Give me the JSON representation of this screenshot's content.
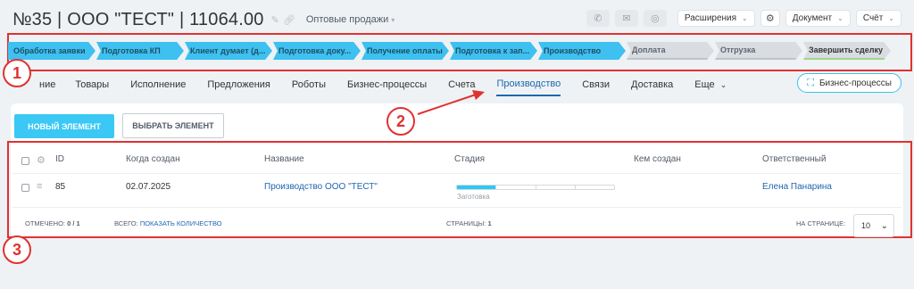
{
  "header": {
    "title": "№35 | ООО \"ТЕСТ\" | 11064.00",
    "category": "Оптовые продажи",
    "extensions_label": "Расширения",
    "document_label": "Документ",
    "invoice_label": "Счёт"
  },
  "stages": [
    {
      "label": "Обработка заявки",
      "state": "done"
    },
    {
      "label": "Подготовка КП",
      "state": "done"
    },
    {
      "label": "Клиент думает (д...",
      "state": "done"
    },
    {
      "label": "Подготовка доку...",
      "state": "done"
    },
    {
      "label": "Получение оплаты",
      "state": "done"
    },
    {
      "label": "Подготовка к зап...",
      "state": "done"
    },
    {
      "label": "Производство",
      "state": "done"
    },
    {
      "label": "Доплата",
      "state": "todo"
    },
    {
      "label": "Отгрузка",
      "state": "todo"
    },
    {
      "label": "Завершить сделку",
      "state": "final"
    }
  ],
  "annotations": [
    "1",
    "2",
    "3"
  ],
  "tabs": [
    {
      "label": "ние",
      "active": false
    },
    {
      "label": "Товары",
      "active": false
    },
    {
      "label": "Исполнение",
      "active": false
    },
    {
      "label": "Предложения",
      "active": false
    },
    {
      "label": "Роботы",
      "active": false
    },
    {
      "label": "Бизнес-процессы",
      "active": false
    },
    {
      "label": "Счета",
      "active": false
    },
    {
      "label": "Производство",
      "active": true
    },
    {
      "label": "Связи",
      "active": false
    },
    {
      "label": "Доставка",
      "active": false
    },
    {
      "label": "Еще",
      "active": false
    }
  ],
  "bp_button_label": "Бизнес-процессы",
  "toolbar": {
    "new_element": "НОВЫЙ ЭЛЕМЕНТ",
    "select_element": "ВЫБРАТЬ ЭЛЕМЕНТ"
  },
  "grid": {
    "columns": [
      "ID",
      "Когда создан",
      "Название",
      "Стадия",
      "Кем создан",
      "Ответственный"
    ],
    "rows": [
      {
        "id": "85",
        "created": "02.07.2025",
        "name": "Производство ООО \"ТЕСТ\"",
        "stage": "Заготовка",
        "stage_progress": "1 of 4",
        "created_by": "",
        "responsible": "Елена Панарина"
      }
    ]
  },
  "footer": {
    "checked_label": "ОТМЕЧЕНО:",
    "checked_value": "0 / 1",
    "total_label": "ВСЕГО:",
    "total_link": "ПОКАЗАТЬ КОЛИЧЕСТВО",
    "pages_label": "СТРАНИЦЫ:",
    "pages_value": "1",
    "per_page_label": "НА СТРАНИЦЕ:",
    "per_page_value": "10"
  },
  "colors": {
    "accent": "#3bc8f5",
    "annotation": "#e03131",
    "link": "#2067b0"
  }
}
